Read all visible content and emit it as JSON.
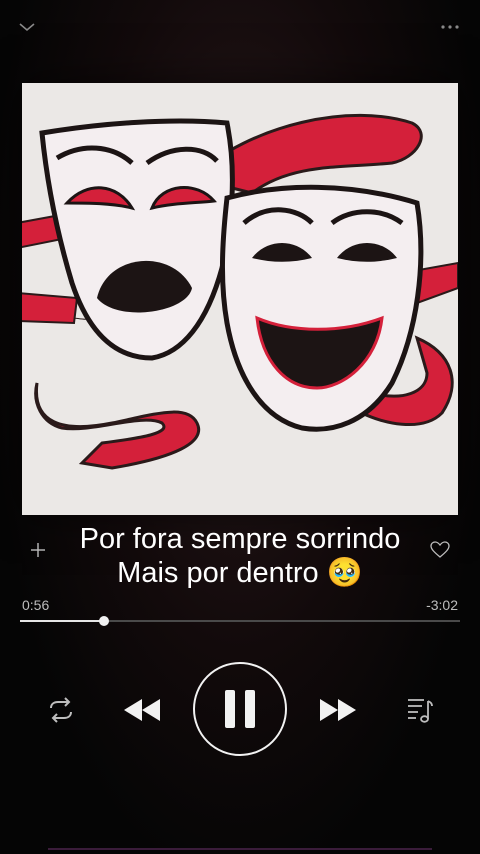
{
  "player": {
    "lyrics": [
      "Por fora sempre sorrindo",
      "Mais por dentro 🥹"
    ],
    "elapsed": "0:56",
    "remaining": "-3:02",
    "progress_fraction": 0.19,
    "is_playing": true,
    "accent": "#e2e2e2"
  },
  "icons": {
    "collapse": "chevron-down-icon",
    "more": "more-options-icon",
    "add": "plus-icon",
    "like": "heart-icon",
    "repeat": "repeat-icon",
    "previous": "rewind-icon",
    "pause": "pause-icon",
    "next": "fast-forward-icon",
    "queue": "music-queue-icon"
  },
  "colors": {
    "background": "#050505",
    "artwork_ribbon": "#d4203a",
    "artwork_bg": "#e9e6e4"
  }
}
